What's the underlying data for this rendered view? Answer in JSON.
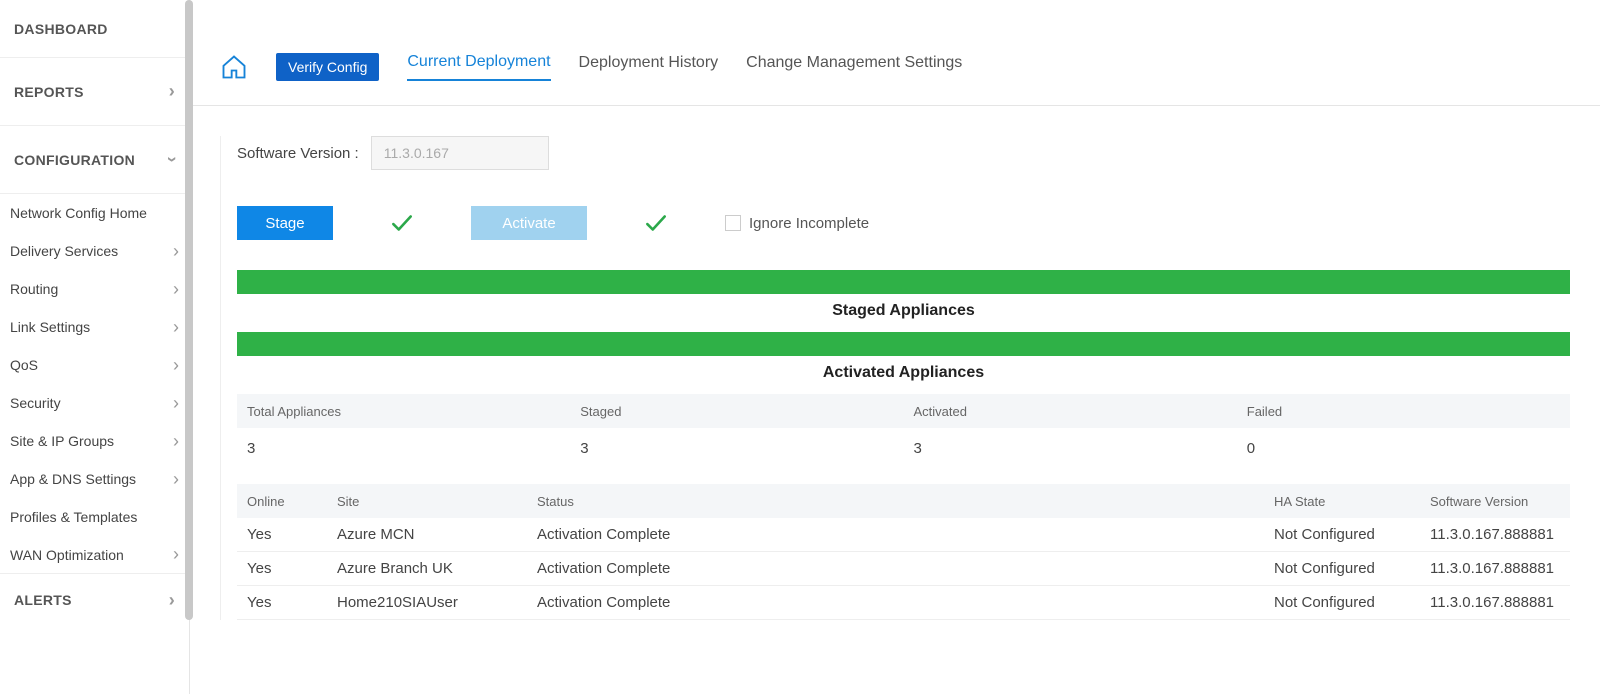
{
  "sidebar": {
    "dashboard": "DASHBOARD",
    "reports": "REPORTS",
    "configuration": "CONFIGURATION",
    "sub": {
      "network_config_home": "Network Config Home",
      "delivery_services": "Delivery Services",
      "routing": "Routing",
      "link_settings": "Link Settings",
      "qos": "QoS",
      "security": "Security",
      "site_ip_groups": "Site & IP Groups",
      "app_dns_settings": "App & DNS Settings",
      "profiles_templates": "Profiles & Templates",
      "wan_optimization": "WAN Optimization"
    },
    "alerts": "ALERTS"
  },
  "tabs": {
    "verify_config": "Verify Config",
    "current_deployment": "Current Deployment",
    "deployment_history": "Deployment History",
    "change_management": "Change Management Settings"
  },
  "software_version": {
    "label": "Software Version :",
    "value": "11.3.0.167"
  },
  "actions": {
    "stage": "Stage",
    "activate": "Activate",
    "ignore_incomplete": "Ignore Incomplete"
  },
  "bars": {
    "staged": "Staged Appliances",
    "activated": "Activated Appliances"
  },
  "summary": {
    "headers": {
      "total": "Total Appliances",
      "staged": "Staged",
      "activated": "Activated",
      "failed": "Failed"
    },
    "row": {
      "total": "3",
      "staged": "3",
      "activated": "3",
      "failed": "0"
    }
  },
  "appliances": {
    "headers": {
      "online": "Online",
      "site": "Site",
      "status": "Status",
      "ha": "HA State",
      "sv": "Software Version"
    },
    "rows": [
      {
        "online": "Yes",
        "site": "Azure MCN",
        "status": "Activation Complete",
        "ha": "Not Configured",
        "sv": "11.3.0.167.888881"
      },
      {
        "online": "Yes",
        "site": "Azure Branch UK",
        "status": "Activation Complete",
        "ha": "Not Configured",
        "sv": "11.3.0.167.888881"
      },
      {
        "online": "Yes",
        "site": "Home210SIAUser",
        "status": "Activation Complete",
        "ha": "Not Configured",
        "sv": "11.3.0.167.888881"
      }
    ]
  }
}
